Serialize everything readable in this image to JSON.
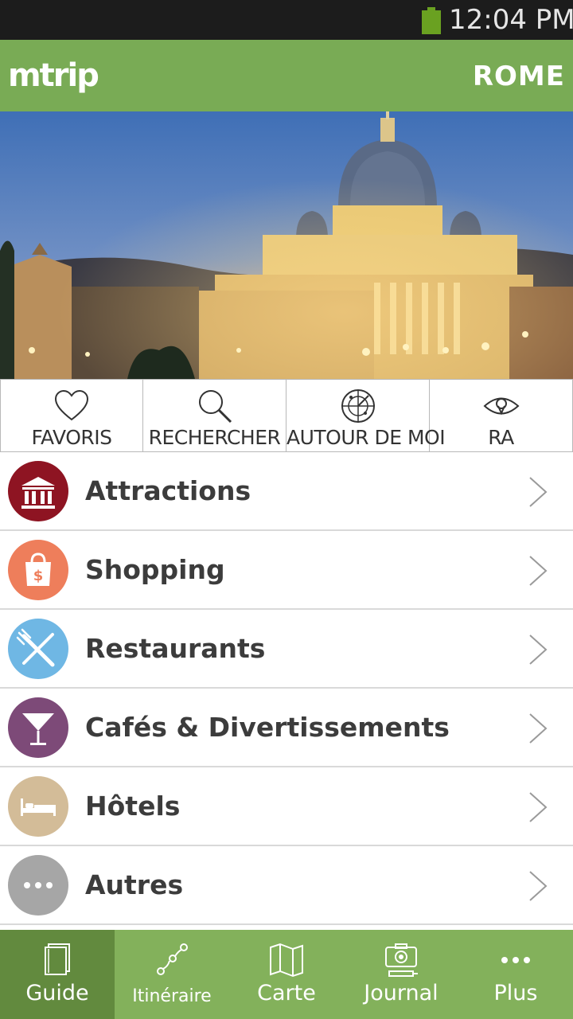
{
  "status_bar": {
    "time": "12:04 PM"
  },
  "app_bar": {
    "logo": "mtrip",
    "city": "ROME"
  },
  "hero": {
    "image": "st-peters-basilica-night"
  },
  "quick_actions": [
    {
      "label": "FAVORIS",
      "icon": "heart-icon"
    },
    {
      "label": "RECHERCHER",
      "icon": "search-icon"
    },
    {
      "label": "AUTOUR DE MOI",
      "icon": "radar-icon"
    },
    {
      "label": "RA",
      "icon": "eye-icon"
    }
  ],
  "categories": [
    {
      "label": "Attractions",
      "icon": "museum-icon",
      "color": "#8e1422"
    },
    {
      "label": "Shopping",
      "icon": "shopping-bag-icon",
      "color": "#ee7e5b"
    },
    {
      "label": "Restaurants",
      "icon": "fork-knife-icon",
      "color": "#6fb7e4"
    },
    {
      "label": "Cafés & Divertissements",
      "icon": "cocktail-icon",
      "color": "#7d4a78"
    },
    {
      "label": "Hôtels",
      "icon": "bed-icon",
      "color": "#d3bc98"
    },
    {
      "label": "Autres",
      "icon": "more-icon",
      "color": "#a6a6a6"
    }
  ],
  "tabs": [
    {
      "label": "Guide",
      "icon": "guide-book-icon",
      "active": true
    },
    {
      "label": "Itinéraire",
      "icon": "route-icon",
      "active": false
    },
    {
      "label": "Carte",
      "icon": "map-icon",
      "active": false
    },
    {
      "label": "Journal",
      "icon": "camera-icon",
      "active": false
    },
    {
      "label": "Plus",
      "icon": "more-dots-icon",
      "active": false
    }
  ],
  "colors": {
    "brand_green": "#79ab55",
    "tab_active": "#628a3e",
    "tab_bar": "#83b15b"
  }
}
